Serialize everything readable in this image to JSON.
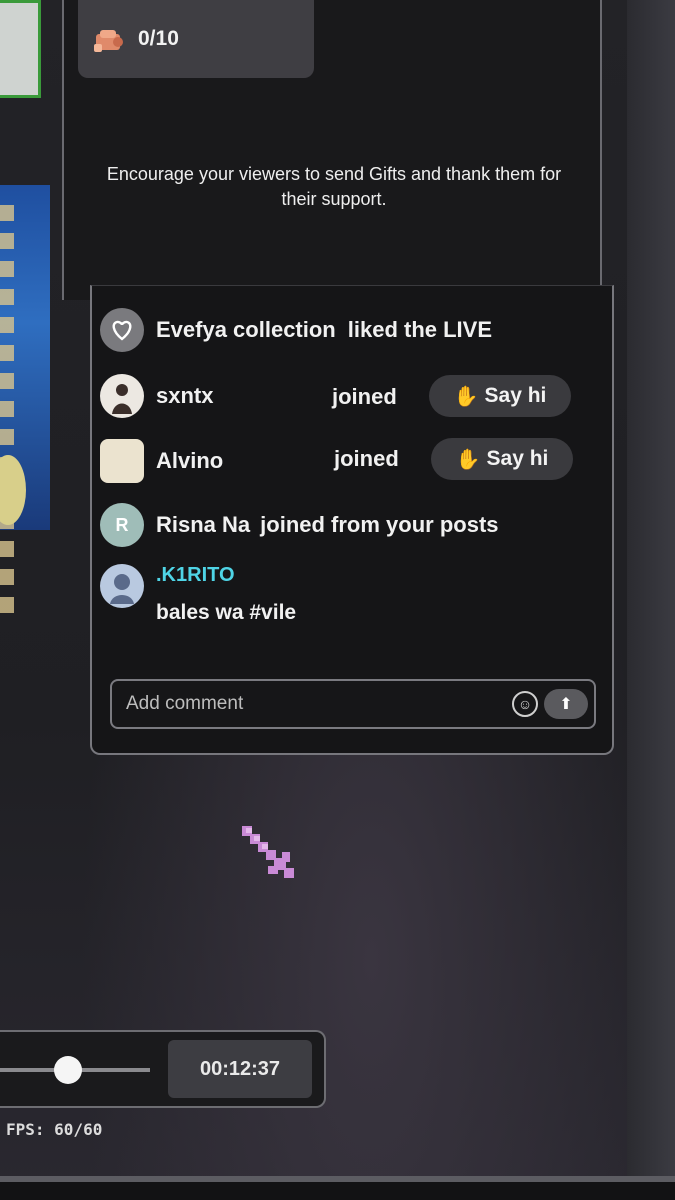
{
  "gift_goal": {
    "icon": "gift-icon",
    "count": "0/10"
  },
  "encourage_text": "Encourage your viewers to send Gifts and thank them for their support.",
  "activity": {
    "liked": {
      "icon": "heart-icon",
      "name": "Evefya collection",
      "action": "liked the LIVE"
    },
    "joins": [
      {
        "name": "sxntx",
        "action": "joined",
        "say_hi": "Say hi"
      },
      {
        "name": "Alvino",
        "action": "joined",
        "say_hi": "Say hi"
      }
    ],
    "posts_join": {
      "initial": "R",
      "name": "Risna Na",
      "action": "joined from your posts"
    },
    "comment": {
      "name": ".K1RITO",
      "message": "bales wa #vile"
    }
  },
  "comment_input": {
    "placeholder": "Add comment"
  },
  "playback": {
    "time": "00:12:37",
    "slider_fraction": 0.45
  },
  "fps": "FPS:  60/60",
  "colors": {
    "accent_name": "#4fd4e6",
    "panel_bg": "#151517",
    "pill_bg": "#3a3a3e"
  }
}
